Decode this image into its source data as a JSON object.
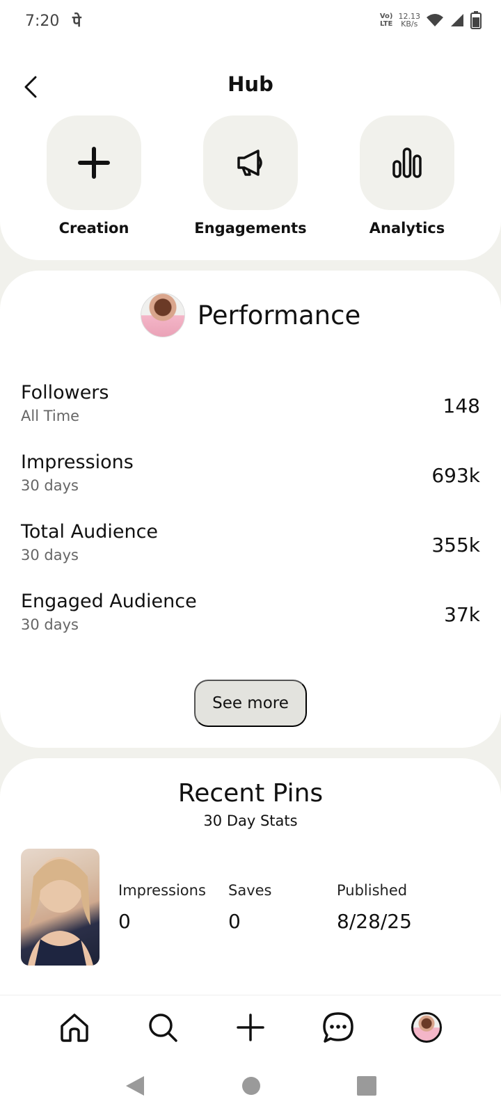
{
  "status_bar": {
    "time": "7:20",
    "extra": "पे",
    "network_label": "VoLTE",
    "speed": "12.13",
    "speed_unit": "KB/s"
  },
  "header": {
    "title": "Hub"
  },
  "hub_tiles": [
    {
      "label": "Creation",
      "icon": "plus-icon"
    },
    {
      "label": "Engagements",
      "icon": "megaphone-icon"
    },
    {
      "label": "Analytics",
      "icon": "bar-chart-icon"
    }
  ],
  "performance": {
    "title": "Performance",
    "metrics": [
      {
        "label": "Followers",
        "period": "All Time",
        "value": "148"
      },
      {
        "label": "Impressions",
        "period": "30 days",
        "value": "693k"
      },
      {
        "label": "Total Audience",
        "period": "30 days",
        "value": "355k"
      },
      {
        "label": "Engaged Audience",
        "period": "30 days",
        "value": "37k"
      }
    ],
    "see_more": "See more"
  },
  "recent_pins": {
    "title": "Recent Pins",
    "subtitle": "30 Day Stats",
    "pins": [
      {
        "stats": [
          {
            "label": "Impressions",
            "value": "0"
          },
          {
            "label": "Saves",
            "value": "0"
          },
          {
            "label": "Published",
            "value": "8/28/25"
          }
        ]
      }
    ]
  },
  "bottom_nav": [
    "home-icon",
    "search-icon",
    "create-icon",
    "messages-icon",
    "profile-avatar"
  ],
  "system_nav": [
    "back",
    "home",
    "recents"
  ]
}
